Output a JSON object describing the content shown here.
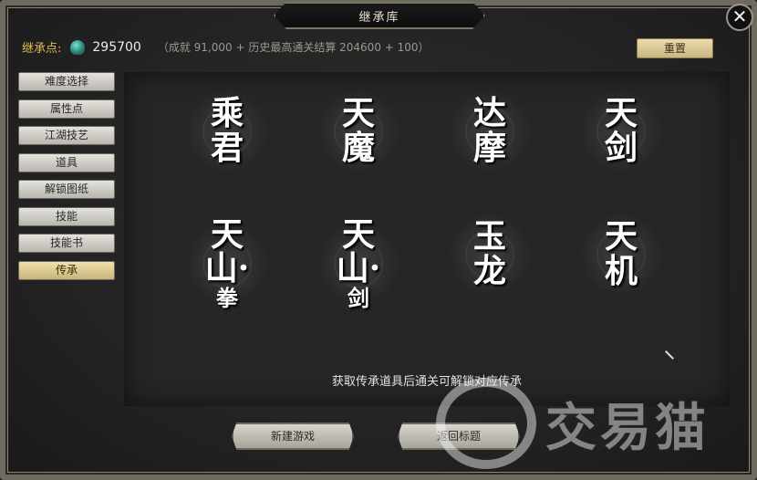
{
  "window": {
    "title": "继承库",
    "close_icon": "close-x-icon"
  },
  "inherit": {
    "label": "继承点:",
    "icon": "gem-icon",
    "points": "295700",
    "formula": "（成就 91,000 + 历史最高通关结算 204600 + 100）"
  },
  "reset_label": "重置",
  "menu": [
    {
      "label": "难度选择"
    },
    {
      "label": "属性点"
    },
    {
      "label": "江湖技艺"
    },
    {
      "label": "道具"
    },
    {
      "label": "解锁图纸"
    },
    {
      "label": "技能"
    },
    {
      "label": "技能书"
    },
    {
      "label": "传承",
      "active": true
    }
  ],
  "heirs": [
    {
      "line1": "乘",
      "line2": "君",
      "line3": ""
    },
    {
      "line1": "天",
      "line2": "魔",
      "line3": ""
    },
    {
      "line1": "达",
      "line2": "摩",
      "line3": ""
    },
    {
      "line1": "天",
      "line2": "剑",
      "line3": ""
    },
    {
      "line1": "天",
      "line2": "山·",
      "line3": "拳"
    },
    {
      "line1": "天",
      "line2": "山·",
      "line3": "剑"
    },
    {
      "line1": "玉",
      "line2": "龙",
      "line3": ""
    },
    {
      "line1": "天",
      "line2": "机",
      "line3": ""
    }
  ],
  "hint": "获取传承道具后通关可解锁对应传承",
  "buttons": {
    "new_game": "新建游戏",
    "back_title": "返回标题"
  },
  "watermark": "交易猫"
}
